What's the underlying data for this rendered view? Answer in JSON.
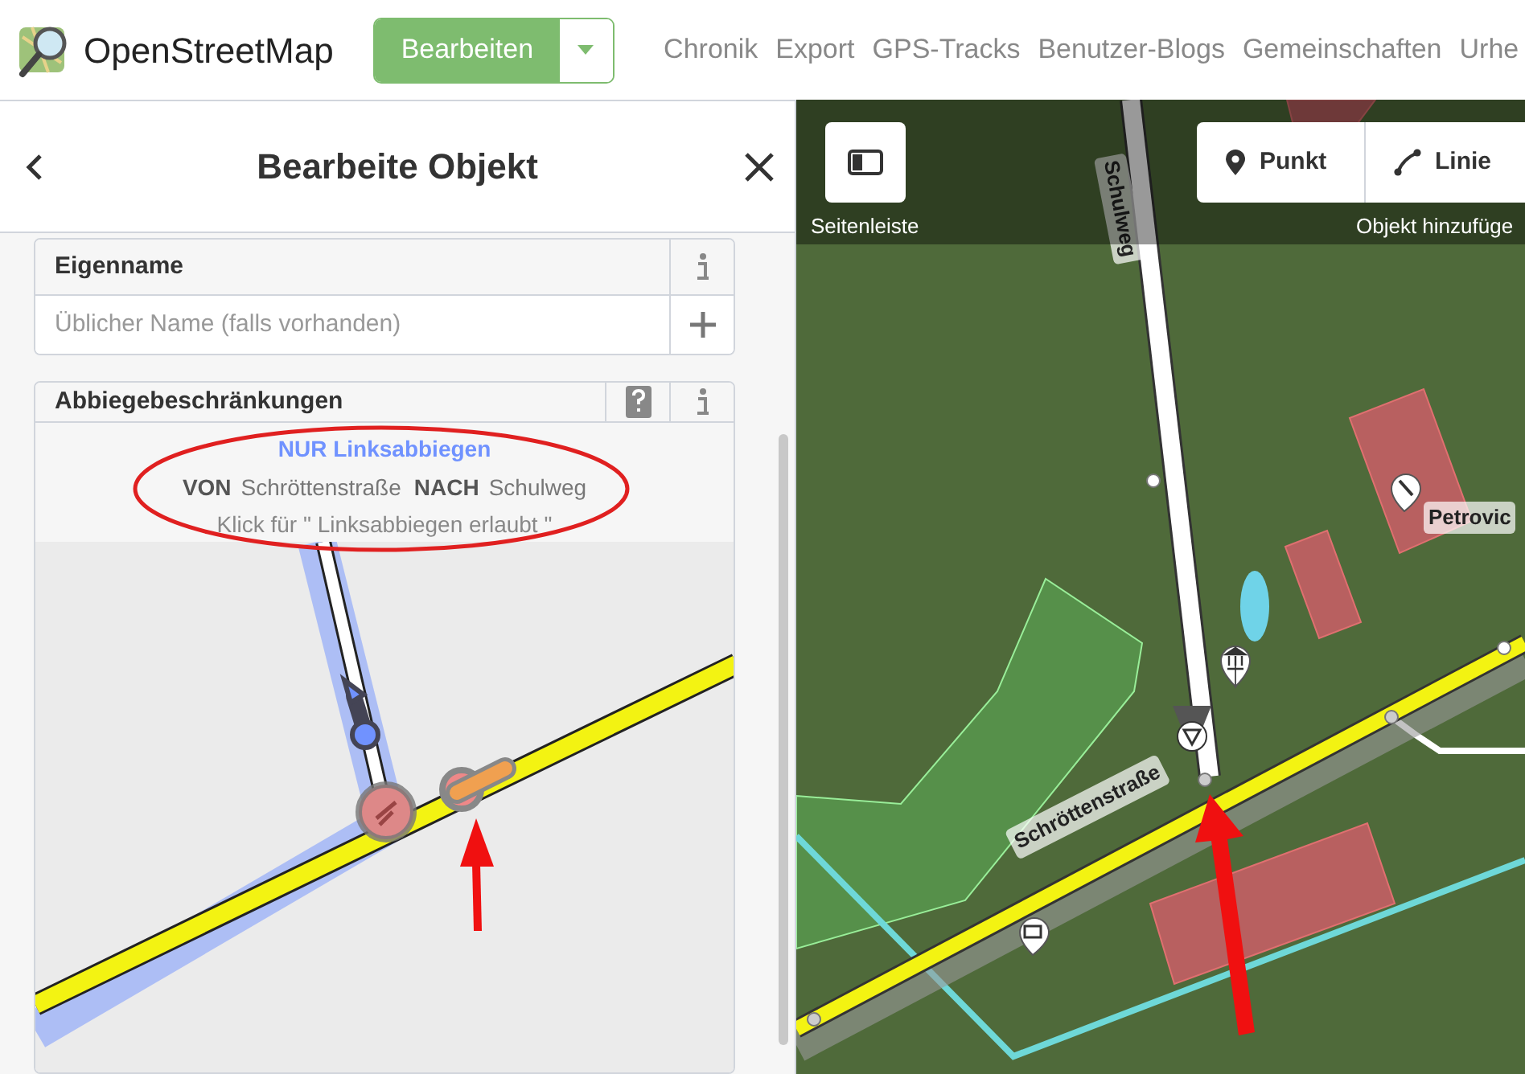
{
  "header": {
    "brand": "OpenStreetMap",
    "edit_button": "Bearbeiten",
    "nav": [
      "Chronik",
      "Export",
      "GPS-Tracks",
      "Benutzer-Blogs",
      "Gemeinschaften",
      "Urhe"
    ]
  },
  "panel": {
    "title": "Bearbeite Objekt",
    "fields": [
      {
        "kind": "text",
        "label": "Eigenname",
        "placeholder": "Üblicher Name (falls vorhanden)"
      },
      {
        "kind": "restrictions",
        "label": "Abbiegebeschränkungen",
        "restriction": "NUR Linksabbiegen",
        "from_label": "VON",
        "from": "Schröttenstraße",
        "to_label": "NACH",
        "to": "Schulweg",
        "hint": "Klick für \" Linksabbiegen erlaubt \""
      }
    ]
  },
  "map": {
    "sidebar_button": "Seitenleiste",
    "add_label": "Objekt hinzufüge",
    "tools": [
      {
        "kind": "point",
        "label": "Punkt"
      },
      {
        "kind": "line",
        "label": "Linie"
      }
    ],
    "labels": [
      {
        "kind": "vertical-road",
        "text": "Schulweg"
      },
      {
        "kind": "diagonal-road",
        "text": "Schröttenstraße"
      },
      {
        "kind": "poi",
        "text": "Petrovic"
      }
    ]
  }
}
